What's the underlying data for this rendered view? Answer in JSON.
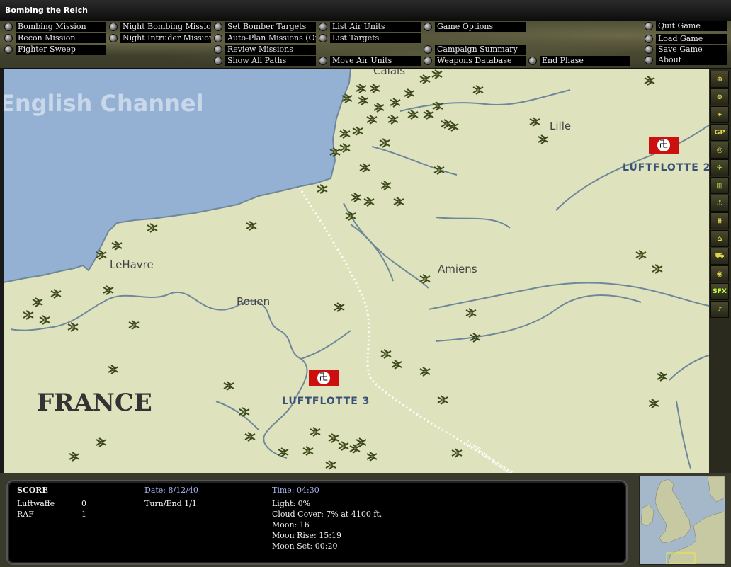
{
  "window": {
    "title": "Bombing the Reich"
  },
  "menu": {
    "col1": [
      "Bombing Mission",
      "Recon Mission",
      "Fighter Sweep"
    ],
    "col2": [
      "Night Bombing Mission",
      "Night Intruder Mission"
    ],
    "col3": [
      "Set Bomber Targets",
      "Auto-Plan Missions (Off)",
      "Review Missions",
      "Show All Paths"
    ],
    "col4": [
      "List Air Units",
      "List Targets",
      "Move Air Units"
    ],
    "col5": [
      "Game Options",
      "Campaign Summary",
      "Weapons Database"
    ],
    "end_phase": "End Phase",
    "col6": [
      "Quit Game",
      "Load Game",
      "Save Game",
      "About"
    ]
  },
  "map": {
    "sea_label": "English Channel",
    "country_label": "FRANCE",
    "cities": {
      "lille": "Lille",
      "lehavre": "LeHavre",
      "amiens": "Amiens",
      "rouen": "Rouen",
      "calais": "Calais"
    },
    "luftflotte2": "LUFTFLOTTE 2",
    "luftflotte3": "LUFTFLOTTE  3",
    "boundary_label": "Luftflotte boundary",
    "colors": {
      "sea": "#94b1d3",
      "land": "#dfe3bd",
      "river": "#6f879b",
      "flag_red": "#cc1010",
      "label_blue": "#3a4f75"
    }
  },
  "toolbar": {
    "icons": [
      "zoom-in-icon",
      "zoom-out-icon",
      "crosshair-icon",
      "gp-icon",
      "target-icon",
      "plane-icon",
      "factory-icon",
      "anchor-icon",
      "bridge-icon",
      "building-icon",
      "convoy-icon",
      "radar-icon",
      "sfx-icon",
      "music-icon"
    ],
    "gp": "GP",
    "sfx": "SFX"
  },
  "score": {
    "heading": "SCORE",
    "luftwaffe_label": "Luftwaffe",
    "luftwaffe_value": "0",
    "raf_label": "RAF",
    "raf_value": "1",
    "date": "Date: 8/12/40",
    "turn": "Turn/End 1/1",
    "time": "Time: 04:30",
    "light": "Light: 0%",
    "cloud": "Cloud Cover: 7% at 4100 ft.",
    "moon": "Moon: 16",
    "moon_rise": "Moon Rise: 15:19",
    "moon_set": "Moon Set: 00:20"
  }
}
